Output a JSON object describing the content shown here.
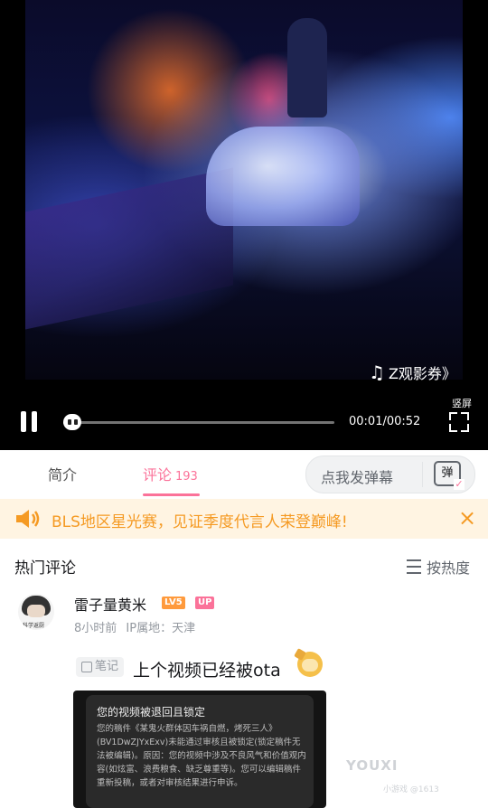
{
  "video": {
    "watermark_text": "Z观影券》",
    "portrait_label": "竖屏",
    "time": "00:01/00:52",
    "progress": 0.02
  },
  "tabs": {
    "intro": "简介",
    "comments": "评论",
    "comments_count": "193",
    "danmaku_placeholder": "点我发弹幕",
    "danmaku_icon_label": "弹"
  },
  "banner": {
    "text": "BLS地区星光赛，见证季度代言人荣登巅峰!",
    "close_icon": "×"
  },
  "comments_header": {
    "title": "热门评论",
    "sort_label": "按热度"
  },
  "comment": {
    "username": "雷子量黄米",
    "level_badge": "LV5",
    "up_badge": "UP",
    "time": "8小时前",
    "ip": "IP属地：天津",
    "note_tag": "笔记",
    "text": "上个视频已经被ota",
    "avatar_tag": "科学返厨"
  },
  "screenshot": {
    "title": "您的视频被退回且锁定",
    "body": "您的稿件《某鬼火群体因车祸自燃，烤死三人》(BV1DwZJYxExv)未能通过审核且被锁定(锁定稿件无法被编辑)。原因：您的视频中涉及不良风气和价值观内容(如炫富、浪费粮食、缺乏尊重等)。您可以编辑稿件重新投稿，或者对审核结果进行申诉。"
  },
  "bottom_watermark": {
    "main": "YOUXI",
    "sub": "小游戏 @1613"
  },
  "colors": {
    "accent": "#fb7299",
    "banner_bg": "#fff4e2",
    "banner_text": "#f59a23"
  }
}
